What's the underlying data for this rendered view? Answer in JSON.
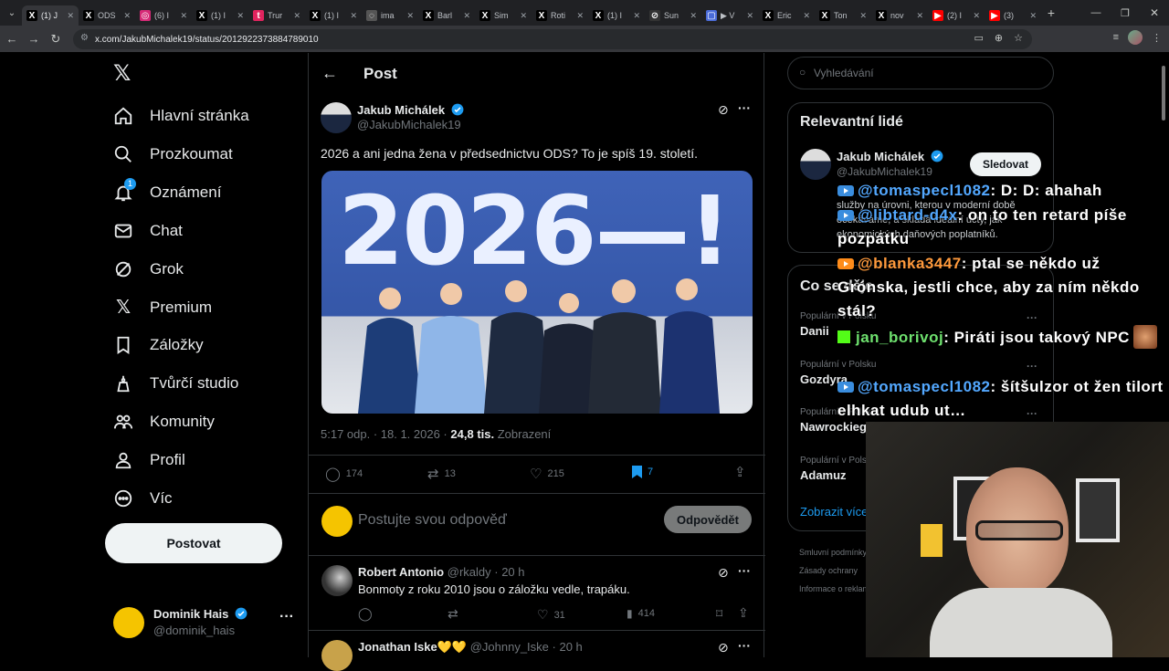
{
  "browser": {
    "tabs": [
      {
        "label": "(1) J",
        "fav": "X",
        "color": "#000",
        "active": true
      },
      {
        "label": "ODS",
        "fav": "X",
        "color": "#000"
      },
      {
        "label": "(6) I",
        "fav": "◎",
        "color": "#d62976"
      },
      {
        "label": "(1) I",
        "fav": "X",
        "color": "#000"
      },
      {
        "label": "Trur",
        "fav": "t",
        "color": "#e0245e"
      },
      {
        "label": "(1) I",
        "fav": "X",
        "color": "#000"
      },
      {
        "label": "ima",
        "fav": "◌",
        "color": "#555"
      },
      {
        "label": "Barl",
        "fav": "X",
        "color": "#000"
      },
      {
        "label": "Sim",
        "fav": "X",
        "color": "#000"
      },
      {
        "label": "Roti",
        "fav": "X",
        "color": "#000"
      },
      {
        "label": "(1) I",
        "fav": "X",
        "color": "#000"
      },
      {
        "label": "Sun",
        "fav": "⊘",
        "color": "#333"
      },
      {
        "label": "▶ V",
        "fav": "▢",
        "color": "#4a6bd8"
      },
      {
        "label": "Eric",
        "fav": "X",
        "color": "#000"
      },
      {
        "label": "Ton",
        "fav": "X",
        "color": "#000"
      },
      {
        "label": "nov",
        "fav": "X",
        "color": "#000"
      },
      {
        "label": "(2) I",
        "fav": "▶",
        "color": "#ff0000"
      },
      {
        "label": "(3)",
        "fav": "▶",
        "color": "#ff0000"
      }
    ],
    "url": "x.com/JakubMichalek19/status/2012922373884789010"
  },
  "nav": {
    "items": [
      {
        "label": "Hlavní stránka",
        "icon": "home-icon"
      },
      {
        "label": "Prozkoumat",
        "icon": "search-icon"
      },
      {
        "label": "Oznámení",
        "icon": "bell-icon",
        "badge": "1"
      },
      {
        "label": "Chat",
        "icon": "mail-icon"
      },
      {
        "label": "Grok",
        "icon": "grok-icon"
      },
      {
        "label": "Premium",
        "icon": "x-logo-icon"
      },
      {
        "label": "Záložky",
        "icon": "bookmark-icon"
      },
      {
        "label": "Tvůrčí studio",
        "icon": "studio-icon"
      },
      {
        "label": "Komunity",
        "icon": "communities-icon"
      },
      {
        "label": "Profil",
        "icon": "profile-icon"
      },
      {
        "label": "Víc",
        "icon": "more-circle-icon"
      }
    ],
    "post_button": "Postovat",
    "account": {
      "name": "Dominik Hais",
      "handle": "@dominik_hais"
    }
  },
  "post": {
    "header_title": "Post",
    "author_name": "Jakub Michálek",
    "author_handle": "@JakubMichalek19",
    "text": "2026 a ani jedna žena v předsednictvu ODS? To je spíš 19. století.",
    "image_banner": "2026—!",
    "meta_time": "5:17 odp. · 18. 1. 2026 ·",
    "meta_views": "24,8 tis.",
    "meta_views_label": "Zobrazení",
    "stats": {
      "replies": "174",
      "reposts": "13",
      "likes": "215",
      "bookmarks": "7"
    },
    "reply_placeholder": "Postujte svou odpověď",
    "reply_button": "Odpovědět"
  },
  "replies": [
    {
      "name": "Robert Antonio",
      "handle": "@rkaldy",
      "time": "· 20 h",
      "text": "Bonmoty z roku 2010 jsou o záložku vedle, trapáku.",
      "likes": "31",
      "views": "414"
    },
    {
      "name": "Jonathan Iske💛💛",
      "handle": "@Johnny_Iske",
      "time": "· 20 h"
    }
  ],
  "right": {
    "search_placeholder": "Vyhledávání",
    "people_title": "Relevantní lidé",
    "person_name": "Jakub Michálek",
    "person_handle": "@JakubMichalek19",
    "follow_button": "Sledovat",
    "person_bio": "služby na úrovni, kterou v moderní době očekáváme, a skládá ideální účty, jak ekonomických daňových poplatníků.",
    "trends_title": "Co se děje",
    "trends": [
      {
        "context": "Populární v Polsku",
        "name": "Danii"
      },
      {
        "context": "Populární v Polsku",
        "name": "Gozdyra"
      },
      {
        "context": "Populární v Polsku",
        "name": "Nawrockiego"
      },
      {
        "context": "Populární v Polsku",
        "name": "Adamuz"
      }
    ],
    "show_more": "Zobrazit více",
    "footer": [
      "Smluvní podmínky",
      "Zásady ochrany",
      "Informace o reklamách"
    ]
  },
  "chat": [
    {
      "platform": "youtube",
      "user": "@tomaspecl1082",
      "msg": ": D: D: ahahah"
    },
    {
      "platform": "youtube",
      "user": "@libtard-d4x",
      "msg": ": on to ten retard píše pozpátku"
    },
    {
      "platform": "youtube",
      "user": "@blanka3447",
      "msg": ": ptal se někdo už Grónska, jestli chce, aby za ním někdo stál?"
    },
    {
      "platform": "kick",
      "user": "jan_borivoj",
      "msg": ": Piráti jsou takový NPC"
    },
    {
      "platform": "youtube",
      "user": "@tomaspecl1082",
      "msg": ": šítšulzor ot žen tilort elhkat udub ut…"
    }
  ]
}
